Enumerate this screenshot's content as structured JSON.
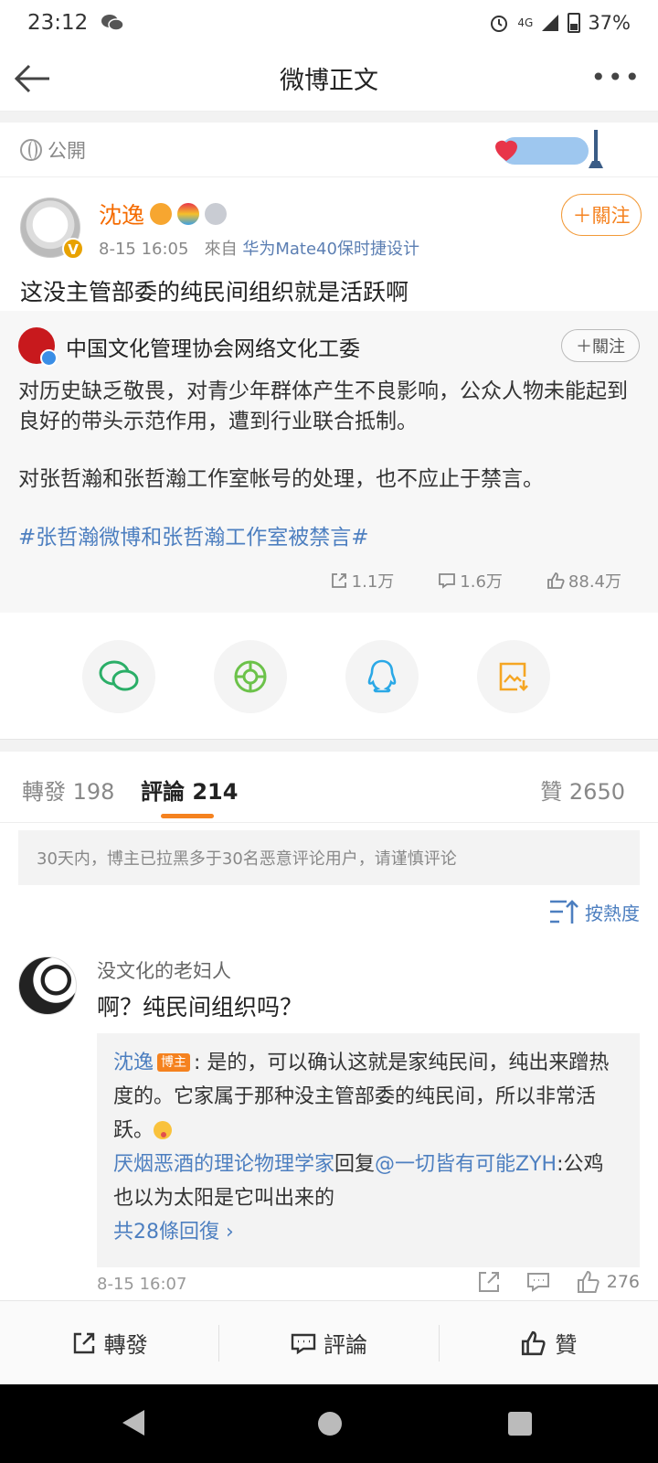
{
  "status": {
    "time": "23:12",
    "network": "4G",
    "battery": "37%"
  },
  "nav": {
    "title": "微博正文"
  },
  "visibility": {
    "label": "公開"
  },
  "post": {
    "author": "沈逸",
    "time": "8-15 16:05",
    "source_prefix": "來自",
    "source": "华为Mate40保时捷设计",
    "follow_label": "＋關注",
    "text": "这没主管部委的纯民间组织就是活跃啊"
  },
  "repost": {
    "author": "中国文化管理协会网络文化工委",
    "follow_label": "＋關注",
    "p1": "对历史缺乏敬畏，对青少年群体产生不良影响，公众人物未能起到良好的带头示范作用，遭到行业联合抵制。",
    "p2": "对张哲瀚和张哲瀚工作室帐号的处理，也不应止于禁言。",
    "hashtag": "#张哲瀚微博和张哲瀚工作室被禁言#",
    "reposts": "1.1万",
    "comments": "1.6万",
    "likes": "88.4万"
  },
  "tabs": {
    "repost": "轉發 198",
    "comment": "評論 214",
    "like": "贊 2650"
  },
  "notice": "30天内，博主已拉黑多于30名恶意评论用户，请谨慎评论",
  "sort": {
    "label": "按熱度"
  },
  "comment": {
    "user": "没文化的老妇人",
    "text": "啊？纯民间组织吗？",
    "reply1_user": "沈逸",
    "reply1_tag": "博主",
    "reply1_text": ": 是的，可以确认这就是家纯民间，纯出来蹭热度的。它家属于那种没主管部委的纯民间，所以非常活跃。",
    "reply2_user": "厌烟恶酒的理论物理学家",
    "reply2_mid": "回复",
    "reply2_target": "@一切皆有可能ZYH",
    "reply2_text": ":公鸡也以为太阳是它叫出来的",
    "more_replies": "共28條回復 ›",
    "time": "8-15 16:07",
    "likes": "276"
  },
  "bottom": {
    "repost": "轉發",
    "comment": "評論",
    "like": "贊"
  },
  "colors": {
    "accent": "#f5821f",
    "link": "#4d7fc0"
  }
}
